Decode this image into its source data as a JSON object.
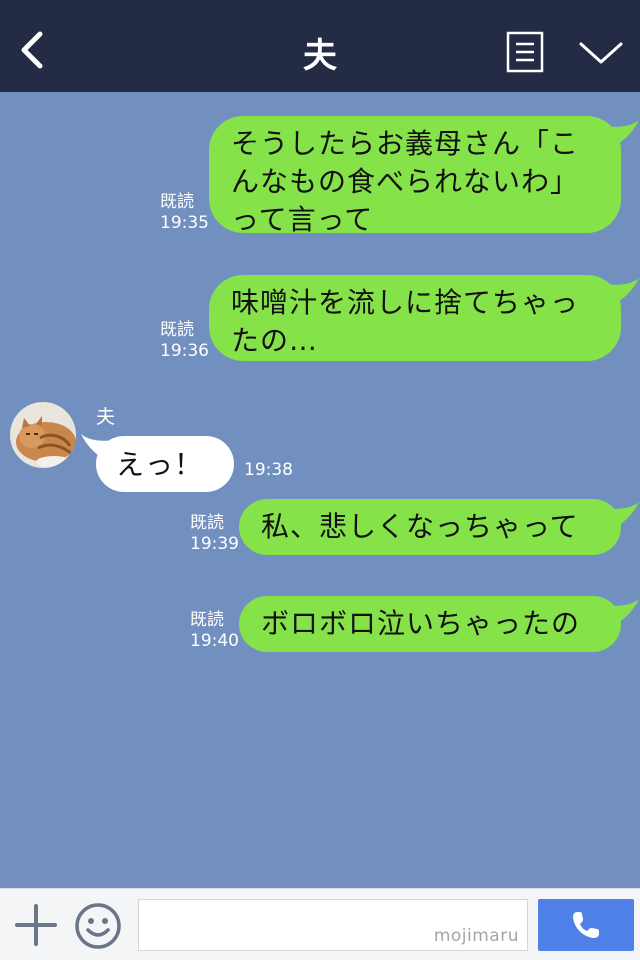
{
  "header": {
    "title": "夫",
    "back_icon": "chevron-left-icon",
    "notes_icon": "notes-icon",
    "menu_icon": "chevron-down-icon"
  },
  "chat": {
    "partner_name": "夫",
    "messages": [
      {
        "direction": "outgoing",
        "lines": [
          "そうしたらお義母さん「こ",
          "んなもの食べられないわ」",
          "って言って"
        ],
        "read": "既読",
        "time": "19:35"
      },
      {
        "direction": "outgoing",
        "lines": [
          "味噌汁を流しに捨てちゃっ",
          "たの…"
        ],
        "read": "既読",
        "time": "19:36"
      },
      {
        "direction": "incoming",
        "lines": [
          "えっ！"
        ],
        "time": "19:38"
      },
      {
        "direction": "outgoing",
        "lines": [
          "私、悲しくなっちゃって"
        ],
        "read": "既読",
        "time": "19:39"
      },
      {
        "direction": "outgoing",
        "lines": [
          "ボロボロ泣いちゃったの"
        ],
        "read": "既読",
        "time": "19:40"
      }
    ]
  },
  "input_bar": {
    "plus_icon": "plus-icon",
    "emoji_icon": "smiley-icon",
    "watermark": "mojimaru",
    "call_icon": "phone-icon"
  },
  "colors": {
    "header_bg": "#232b45",
    "chat_bg": "#7290bf",
    "outgoing_bubble": "#85e249",
    "incoming_bubble": "#ffffff",
    "call_button": "#4f80e8"
  }
}
